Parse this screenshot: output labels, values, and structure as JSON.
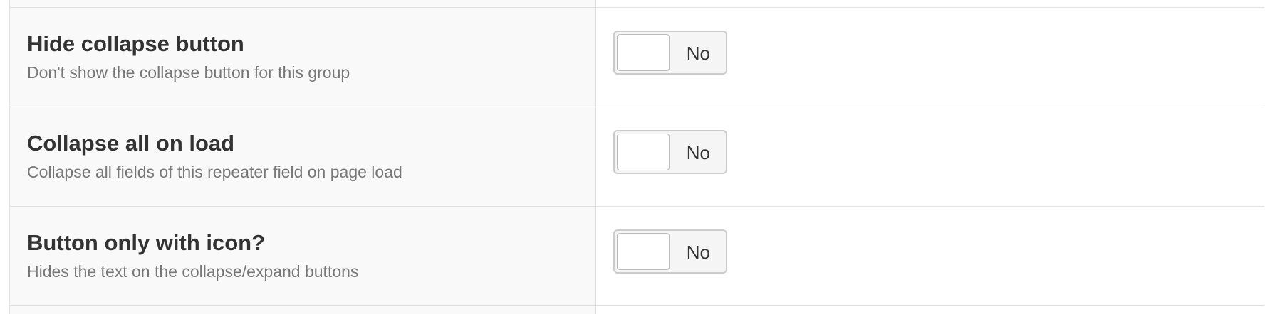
{
  "settings": [
    {
      "title": "Hide collapse button",
      "description": "Don't show the collapse button for this group",
      "toggle": {
        "state_label": "No",
        "checked": false
      }
    },
    {
      "title": "Collapse all on load",
      "description": "Collapse all fields of this repeater field on page load",
      "toggle": {
        "state_label": "No",
        "checked": false
      }
    },
    {
      "title": "Button only with icon?",
      "description": "Hides the text on the collapse/expand buttons",
      "toggle": {
        "state_label": "No",
        "checked": false
      }
    }
  ]
}
